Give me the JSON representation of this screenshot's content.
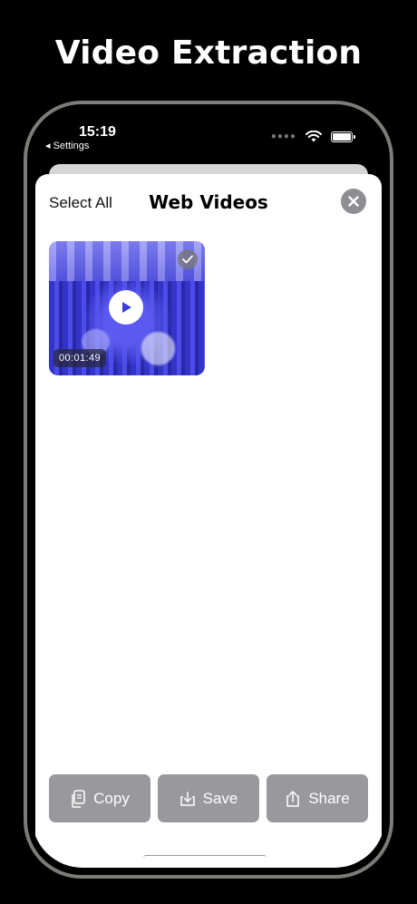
{
  "headline": "Video Extraction",
  "status_bar": {
    "time": "15:19",
    "back_label": "◂ Settings"
  },
  "sheet": {
    "select_all": "Select All",
    "title": "Web Videos"
  },
  "videos": [
    {
      "duration": "00:01:49",
      "selected": true
    }
  ],
  "actions": {
    "copy": "Copy",
    "save": "Save",
    "share": "Share"
  }
}
